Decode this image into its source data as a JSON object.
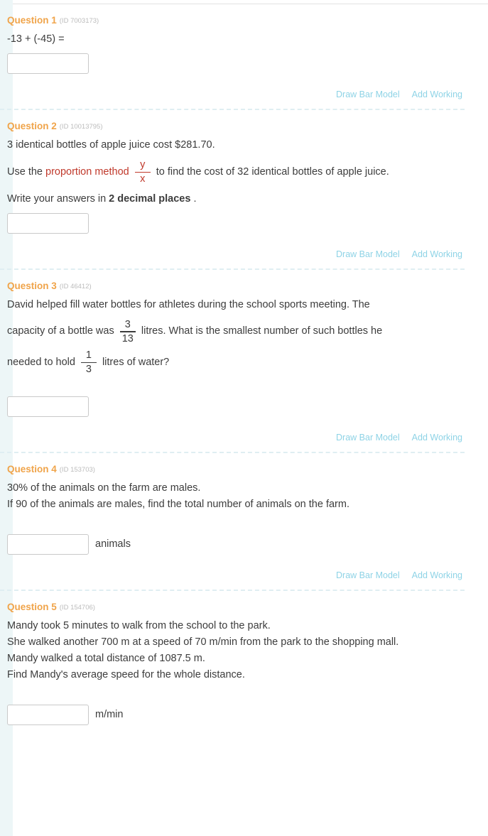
{
  "theme": {
    "accent_orange": "#f0a44a",
    "link_blue": "#8ed3e6",
    "highlight_red": "#c0392b",
    "strip_cyan": "#edf6f7",
    "divider": "#dfeef2"
  },
  "actions": {
    "draw_bar_model": "Draw Bar Model",
    "add_working": "Add Working"
  },
  "questions": [
    {
      "title": "Question 1",
      "id_label": "(ID 7003173)",
      "line1": "-13 + (-45) =",
      "answer_value": "",
      "answer_unit": ""
    },
    {
      "title": "Question 2",
      "id_label": "(ID 10013795)",
      "line1": "3 identical bottles of apple juice cost $281.70.",
      "line2_a": "Use the",
      "line2_highlight": "proportion method",
      "frac_num": "y",
      "frac_den": "x",
      "line2_b": "to find the cost of 32 identical bottles of apple juice.",
      "line3_a": "Write your answers in",
      "line3_bold": "2 decimal places",
      "line3_b": ".",
      "answer_value": "",
      "answer_unit": ""
    },
    {
      "title": "Question 3",
      "id_label": "(ID 46412)",
      "line1": "David helped fill water bottles for athletes during the school sports meeting. The",
      "line2_a": "capacity of a bottle was",
      "frac1_num": "3",
      "frac1_den": "13",
      "line2_b": "litres. What is the smallest number of such bottles he",
      "line3_a": "needed to hold",
      "frac2_num": "1",
      "frac2_den": "3",
      "line3_b": "litres of water?",
      "answer_value": "",
      "answer_unit": ""
    },
    {
      "title": "Question 4",
      "id_label": "(ID 153703)",
      "line1": "30% of the animals on the farm are males.",
      "line2": "If 90 of the animals are males, find the total number of animals on the farm.",
      "answer_value": "",
      "answer_unit": "animals"
    },
    {
      "title": "Question 5",
      "id_label": "(ID 154706)",
      "line1": "Mandy took 5 minutes to walk from the school to the park.",
      "line2": "She walked another 700 m at a speed of 70 m/min from the park to the shopping mall.",
      "line3": "Mandy walked a total distance of 1087.5 m.",
      "line4": "Find Mandy's average speed for the whole distance.",
      "answer_value": "",
      "answer_unit": "m/min"
    }
  ]
}
